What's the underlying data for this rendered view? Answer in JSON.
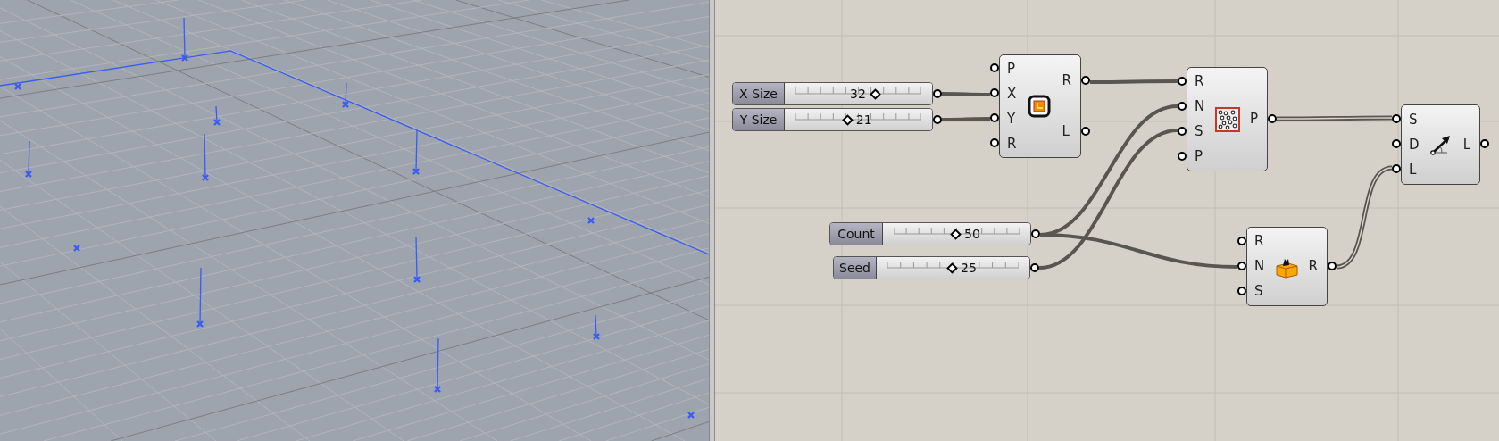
{
  "sliders": [
    {
      "label": "X Size",
      "value": "32",
      "level": 0.63
    },
    {
      "label": "Y Size",
      "value": "21",
      "level": 0.41
    },
    {
      "label": "Count",
      "value": "50",
      "level": 0.49
    },
    {
      "label": "Seed",
      "value": "25",
      "level": 0.49
    }
  ],
  "components": [
    {
      "kind": "rectangle",
      "inputs": [
        "P",
        "X",
        "Y",
        "R"
      ],
      "outputs": [
        "R",
        "L"
      ]
    },
    {
      "kind": "populate",
      "inputs": [
        "R",
        "N",
        "S",
        "P"
      ],
      "outputs": [
        "P"
      ]
    },
    {
      "kind": "line_sdl",
      "inputs": [
        "S",
        "D",
        "L"
      ],
      "outputs": [
        "L"
      ]
    },
    {
      "kind": "random",
      "inputs": [
        "R",
        "N",
        "S"
      ],
      "outputs": [
        "R"
      ]
    }
  ]
}
